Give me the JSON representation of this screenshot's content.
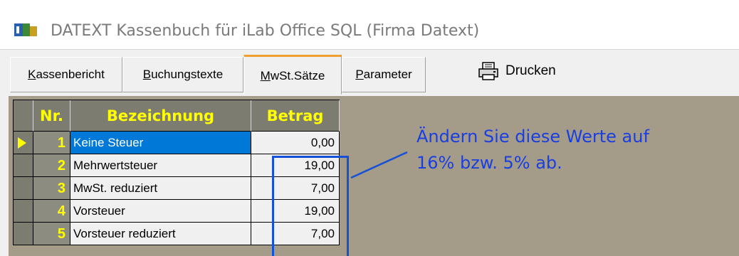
{
  "window": {
    "title": "DATEXT Kassenbuch für iLab Office SQL (Firma Datext)",
    "icon": "app-icon"
  },
  "tabs": [
    {
      "label_prefix": "",
      "label_underlined": "K",
      "label_rest": "assenbericht",
      "active": false
    },
    {
      "label_prefix": "",
      "label_underlined": "B",
      "label_rest": "uchungstexte",
      "active": false
    },
    {
      "label_prefix": "",
      "label_underlined": "M",
      "label_rest": "wSt.Sätze",
      "active": true
    },
    {
      "label_prefix": "",
      "label_underlined": "P",
      "label_rest": "arameter",
      "active": false
    }
  ],
  "toolbar": {
    "print_label": "Drucken",
    "print_icon": "printer-icon"
  },
  "grid": {
    "columns": [
      "Nr.",
      "Bezeichnung",
      "Betrag"
    ],
    "rows": [
      {
        "nr": "1",
        "bezeichnung": "Keine Steuer",
        "betrag": "0,00",
        "selected": true
      },
      {
        "nr": "2",
        "bezeichnung": "Mehrwertsteuer",
        "betrag": "19,00",
        "selected": false
      },
      {
        "nr": "3",
        "bezeichnung": "MwSt. reduziert",
        "betrag": "7,00",
        "selected": false
      },
      {
        "nr": "4",
        "bezeichnung": "Vorsteuer",
        "betrag": "19,00",
        "selected": false
      },
      {
        "nr": "5",
        "bezeichnung": "Vorsteuer reduziert",
        "betrag": "7,00",
        "selected": false
      }
    ]
  },
  "annotation": {
    "line1": "Ändern Sie diese Werte auf",
    "line2": "16% bzw. 5% ab.",
    "color": "#1a3fe0"
  },
  "colors": {
    "header_text": "#ffff00",
    "header_bg": "#7c7c70",
    "panel_bg": "#a59b89",
    "selection": "#0078d7",
    "active_tab_accent": "#f0a030"
  }
}
